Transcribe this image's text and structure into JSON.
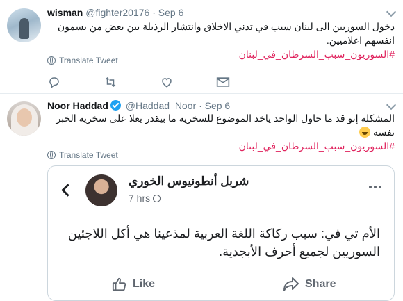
{
  "tweets": [
    {
      "name": "wisman",
      "handle": "@fighter20176",
      "date": "Sep 6",
      "text": "دخول السوريين الى لبنان سبب في تدني الاخلاق وانتشار الرذيلة بين بعض من يسمون انفسهم اعلاميين.",
      "hashtag": "#السوريون_سبب_السرطان_في_لبنان",
      "translate_label": "Translate Tweet"
    },
    {
      "name": "Noor Haddad",
      "handle": "@Haddad_Noor",
      "date": "Sep 6",
      "text": "المشكلة إنو قد ما حاول الواحد ياخد الموضوع للسخرية ما بيقدر يعلا على سخرية الخبر نفسه",
      "hashtag": "#السوريون_سبب_السرطان_في_لبنان",
      "translate_label": "Translate Tweet"
    }
  ],
  "card": {
    "author": "شربل أنطونيوس الخوري",
    "time": "7 hrs",
    "text": "الأم تي في: سبب ركاكة اللغة العربية لمذعينا هي أكل اللاجئين السوريين لجميع أحرف الأبجدية.",
    "like_label": "Like",
    "share_label": "Share"
  }
}
